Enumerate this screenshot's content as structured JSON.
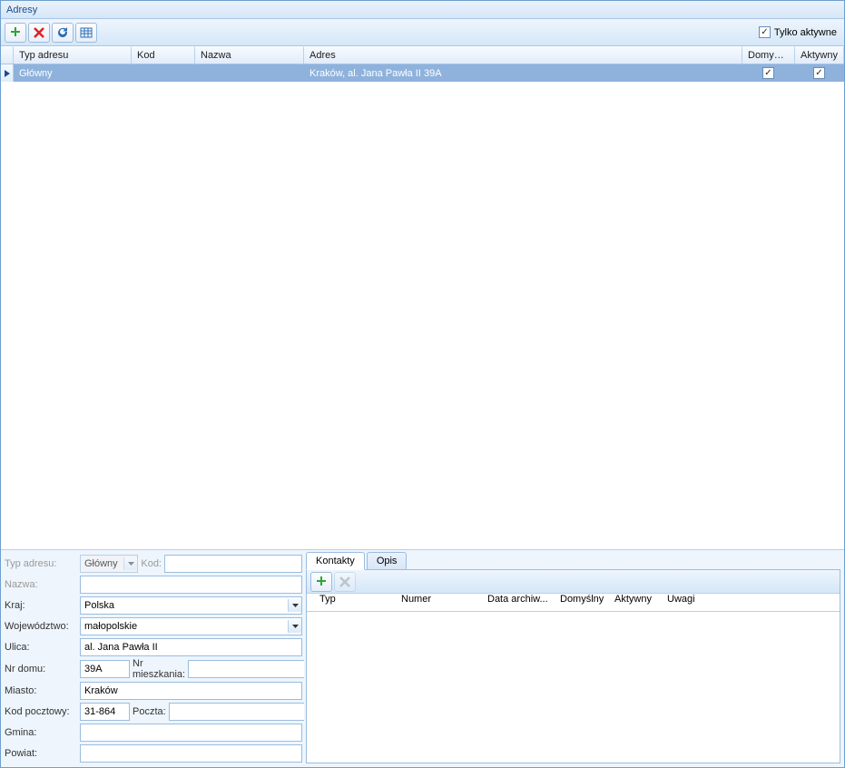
{
  "window": {
    "title": "Adresy"
  },
  "toolbar": {
    "add_icon": "plus",
    "delete_icon": "x",
    "refresh_icon": "refresh",
    "export_icon": "table",
    "only_active_label": "Tylko aktywne",
    "only_active_checked": true
  },
  "grid": {
    "columns": {
      "typ_adresu": "Typ adresu",
      "kod": "Kod",
      "nazwa": "Nazwa",
      "adres": "Adres",
      "domyslny": "Domyślny",
      "aktywny": "Aktywny"
    },
    "rows": [
      {
        "typ_adresu": "Główny",
        "kod": "",
        "nazwa": "",
        "adres": "Kraków, al. Jana Pawła II 39A",
        "domyslny": true,
        "aktywny": true
      }
    ]
  },
  "form": {
    "labels": {
      "typ_adresu": "Typ adresu:",
      "kod": "Kod:",
      "nazwa": "Nazwa:",
      "kraj": "Kraj:",
      "wojewodztwo": "Województwo:",
      "ulica": "Ulica:",
      "nr_domu": "Nr domu:",
      "nr_mieszkania": "Nr mieszkania:",
      "miasto": "Miasto:",
      "kod_pocztowy": "Kod pocztowy:",
      "poczta": "Poczta:",
      "gmina": "Gmina:",
      "powiat": "Powiat:"
    },
    "values": {
      "typ_adresu": "Główny",
      "kod": "",
      "nazwa": "",
      "kraj": "Polska",
      "wojewodztwo": "małopolskie",
      "ulica": "al. Jana Pawła II",
      "nr_domu": "39A",
      "nr_mieszkania": "",
      "miasto": "Kraków",
      "kod_pocztowy": "31-864",
      "poczta": "",
      "gmina": "",
      "powiat": ""
    }
  },
  "right_pane": {
    "tabs": {
      "kontakty": "Kontakty",
      "opis": "Opis"
    },
    "sub_grid_columns": {
      "typ": "Typ",
      "numer": "Numer",
      "data_archiw": "Data archiw...",
      "domyslny": "Domyślny",
      "aktywny": "Aktywny",
      "uwagi": "Uwagi"
    }
  }
}
